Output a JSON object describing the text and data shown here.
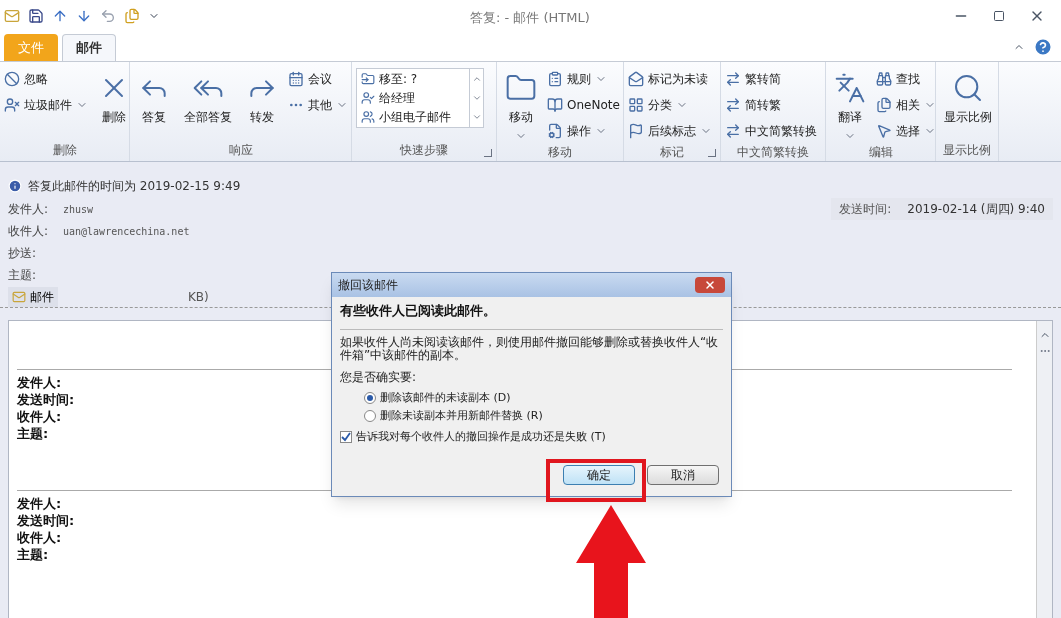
{
  "window": {
    "title": "答复:  -  邮件 (HTML)"
  },
  "tabs": [
    {
      "label": "文件",
      "kind": "file",
      "selected": false
    },
    {
      "label": "邮件",
      "kind": "tab",
      "selected": true
    }
  ],
  "ribbon": {
    "groups": [
      {
        "label": "删除",
        "launcher": false,
        "items": [
          {
            "kind": "small",
            "label": "忽略",
            "dropdown": false
          },
          {
            "kind": "small",
            "label": "垃圾邮件",
            "dropdown": true
          },
          {
            "kind": "large",
            "label": "删除",
            "dropdown": false
          }
        ]
      },
      {
        "label": "响应",
        "launcher": false,
        "items": [
          {
            "kind": "large",
            "label": "答复",
            "dropdown": false
          },
          {
            "kind": "large",
            "label": "全部答复",
            "dropdown": false
          },
          {
            "kind": "large",
            "label": "转发",
            "dropdown": false
          },
          {
            "kind": "small",
            "label": "会议",
            "dropdown": false
          },
          {
            "kind": "small",
            "label": "其他",
            "dropdown": true
          }
        ]
      },
      {
        "label": "快速步骤",
        "launcher": true,
        "items": [
          {
            "kind": "quick",
            "label": "移至: ?"
          },
          {
            "kind": "quick",
            "label": "给经理"
          },
          {
            "kind": "quick",
            "label": "小组电子邮件"
          }
        ]
      },
      {
        "label": "移动",
        "launcher": false,
        "items": [
          {
            "kind": "large",
            "label": "移动",
            "dropdown": true
          },
          {
            "kind": "small",
            "label": "规则",
            "dropdown": true
          },
          {
            "kind": "small",
            "label": "OneNote",
            "dropdown": false
          },
          {
            "kind": "small",
            "label": "操作",
            "dropdown": true
          }
        ]
      },
      {
        "label": "标记",
        "launcher": true,
        "items": [
          {
            "kind": "small",
            "label": "标记为未读",
            "dropdown": false
          },
          {
            "kind": "small",
            "label": "分类",
            "dropdown": true
          },
          {
            "kind": "small",
            "label": "后续标志",
            "dropdown": true
          }
        ]
      },
      {
        "label": "中文简繁转换",
        "launcher": false,
        "items": [
          {
            "kind": "small",
            "label": "繁转简",
            "dropdown": false
          },
          {
            "kind": "small",
            "label": "简转繁",
            "dropdown": false
          },
          {
            "kind": "small",
            "label": "中文简繁转换",
            "dropdown": false
          }
        ]
      },
      {
        "label": "编辑",
        "launcher": false,
        "items": [
          {
            "kind": "large",
            "label": "翻译",
            "dropdown": true
          },
          {
            "kind": "small",
            "label": "查找",
            "dropdown": false
          },
          {
            "kind": "small",
            "label": "相关",
            "dropdown": true
          },
          {
            "kind": "small",
            "label": "选择",
            "dropdown": true
          }
        ]
      },
      {
        "label": "显示比例",
        "launcher": false,
        "items": [
          {
            "kind": "large",
            "label": "显示比例",
            "dropdown": false
          }
        ]
      }
    ]
  },
  "info_bar": {
    "text": "答复此邮件的时间为 2019-02-15 9:49"
  },
  "header": {
    "fields": [
      {
        "label": "发件人:",
        "value": "zhusw"
      },
      {
        "label": "收件人:",
        "value": "uan@lawrencechina.net"
      },
      {
        "label": "抄送:"
      },
      {
        "label": "主题:"
      }
    ],
    "sent_label": "发送时间:",
    "sent_value": "2019-02-14 (周四) 9:40"
  },
  "message_tab": {
    "label": "邮件",
    "size": "KB)"
  },
  "body": {
    "blocks": [
      {
        "fields": [
          {
            "label": "发件人:"
          },
          {
            "label": "发送时间:"
          },
          {
            "label": "收件人:"
          },
          {
            "label": "主题:"
          }
        ]
      },
      {
        "fields": [
          {
            "label": "发件人:"
          },
          {
            "label": "发送时间:"
          },
          {
            "label": "收件人:"
          },
          {
            "label": "主题:"
          }
        ]
      }
    ]
  },
  "dialog": {
    "title": "撤回该邮件",
    "heading": "有些收件人已阅读此邮件。",
    "description": "如果收件人尚未阅读该邮件，则使用邮件撤回能够删除或替换收件人“收件箱”中该邮件的副本。",
    "question": "您是否确实要:",
    "options": [
      {
        "label": "删除该邮件的未读副本 (D)",
        "selected": true
      },
      {
        "label": "删除未读副本并用新邮件替换 (R)",
        "selected": false
      }
    ],
    "checkbox": {
      "label": "告诉我对每个收件人的撤回操作是成功还是失败 (T)",
      "checked": true
    },
    "buttons": [
      {
        "label": "确定",
        "highlighted": true
      },
      {
        "label": "取消",
        "highlighted": false
      }
    ]
  }
}
